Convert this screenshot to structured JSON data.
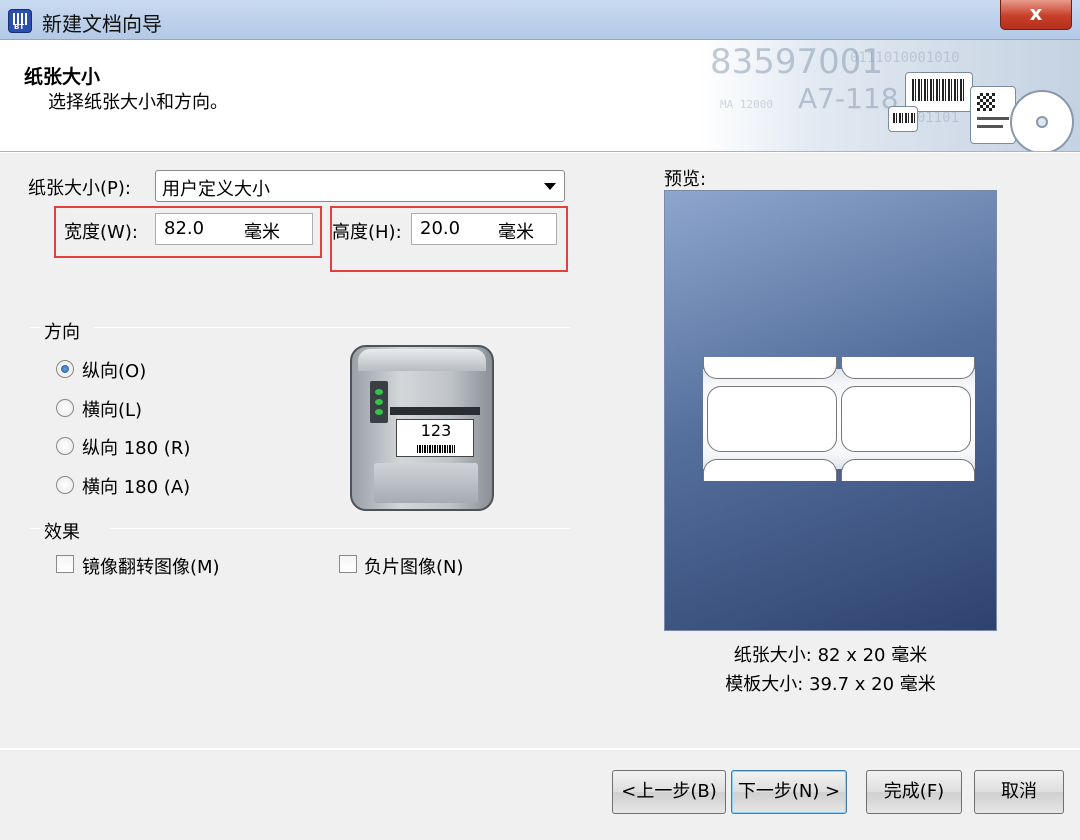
{
  "window": {
    "title": "新建文档向导",
    "close_label": "x"
  },
  "header": {
    "title": "纸张大小",
    "subtitle": "选择纸张大小和方向。",
    "banner_text": [
      "83597001",
      "A7-118",
      "0111010001010",
      "0101101",
      "MA 12000"
    ]
  },
  "paper": {
    "size_label": "纸张大小(P):",
    "size_value": "用户定义大小",
    "width_label": "宽度(W):",
    "width_value": "82.0",
    "width_unit": "毫米",
    "height_label": "高度(H):",
    "height_value": "20.0",
    "height_unit": "毫米"
  },
  "orientation": {
    "group_label": "方向",
    "options": [
      {
        "label": "纵向(O)",
        "selected": true
      },
      {
        "label": "横向(L)",
        "selected": false
      },
      {
        "label": "纵向 180 (R)",
        "selected": false
      },
      {
        "label": "横向 180 (A)",
        "selected": false
      }
    ]
  },
  "printer_label_text": "123",
  "effects": {
    "group_label": "效果",
    "mirror_label": "镜像翻转图像(M)",
    "mirror_checked": false,
    "negative_label": "负片图像(N)",
    "negative_checked": false
  },
  "preview": {
    "label": "预览:",
    "paper_size_text": "纸张大小: 82 x 20 毫米",
    "template_size_text": "模板大小: 39.7 x 20 毫米"
  },
  "buttons": {
    "back": "<上一步(B)",
    "next": "下一步(N) >",
    "finish": "完成(F)",
    "cancel": "取消"
  },
  "colors": {
    "highlight_box": "#e04040",
    "preview_bg_dark": "#2e426f",
    "preview_bg_light": "#8ea6cd",
    "close_button": "#c8402a"
  }
}
